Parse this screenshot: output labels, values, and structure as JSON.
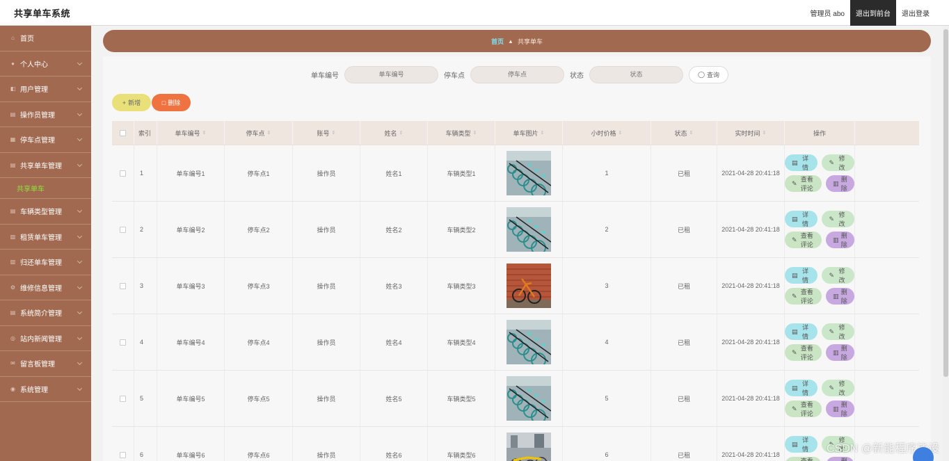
{
  "header": {
    "title": "共享单车系统",
    "user": "管理员 abo",
    "front_label": "退出到前台",
    "logout_label": "退出登录"
  },
  "sidebar": {
    "items": [
      {
        "label": "首页",
        "icon": "home-icon"
      },
      {
        "label": "个人中心",
        "icon": "user-icon"
      },
      {
        "label": "用户管理",
        "icon": "users-icon"
      },
      {
        "label": "操作员管理",
        "icon": "list-icon"
      },
      {
        "label": "停车点管理",
        "icon": "grid-icon"
      },
      {
        "label": "共享单车管理",
        "icon": "list-icon"
      },
      {
        "label": "车辆类型管理",
        "icon": "list-icon"
      },
      {
        "label": "租赁单车管理",
        "icon": "chart-icon"
      },
      {
        "label": "归还单车管理",
        "icon": "chart-icon"
      },
      {
        "label": "维修信息管理",
        "icon": "settings-icon"
      },
      {
        "label": "系统简介管理",
        "icon": "list-icon"
      },
      {
        "label": "站内新闻管理",
        "icon": "globe-icon"
      },
      {
        "label": "留言板管理",
        "icon": "message-icon"
      },
      {
        "label": "系统管理",
        "icon": "database-icon"
      }
    ],
    "active_sub": "共享单车"
  },
  "breadcrumb": {
    "home": "首页",
    "current": "共享单车"
  },
  "search": {
    "fields": [
      {
        "label": "单车编号",
        "placeholder": "单车编号"
      },
      {
        "label": "停车点",
        "placeholder": "停车点"
      },
      {
        "label": "状态",
        "placeholder": "状态"
      }
    ],
    "button": "查询"
  },
  "actions": {
    "add": "新增",
    "delete": "删除"
  },
  "table": {
    "columns": [
      "索引",
      "单车编号",
      "停车点",
      "账号",
      "姓名",
      "车辆类型",
      "单车图片",
      "小时价格",
      "状态",
      "实时时间",
      "操作"
    ],
    "rows": [
      {
        "index": "1",
        "bike_no": "单车编号1",
        "stop": "停车点1",
        "account": "操作员",
        "name": "姓名1",
        "type": "车辆类型1",
        "price": "1",
        "status": "已租",
        "time": "2021-04-28 20:41:18",
        "img": "rack"
      },
      {
        "index": "2",
        "bike_no": "单车编号2",
        "stop": "停车点2",
        "account": "操作员",
        "name": "姓名2",
        "type": "车辆类型2",
        "price": "2",
        "status": "已租",
        "time": "2021-04-28 20:41:18",
        "img": "rack"
      },
      {
        "index": "3",
        "bike_no": "单车编号3",
        "stop": "停车点3",
        "account": "操作员",
        "name": "姓名3",
        "type": "车辆类型3",
        "price": "3",
        "status": "已租",
        "time": "2021-04-28 20:41:18",
        "img": "wall"
      },
      {
        "index": "4",
        "bike_no": "单车编号4",
        "stop": "停车点4",
        "account": "操作员",
        "name": "姓名4",
        "type": "车辆类型4",
        "price": "4",
        "status": "已租",
        "time": "2021-04-28 20:41:18",
        "img": "rack"
      },
      {
        "index": "5",
        "bike_no": "单车编号5",
        "stop": "停车点5",
        "account": "操作员",
        "name": "姓名5",
        "type": "车辆类型5",
        "price": "5",
        "status": "已租",
        "time": "2021-04-28 20:41:18",
        "img": "rack"
      },
      {
        "index": "6",
        "bike_no": "单车编号6",
        "stop": "停车点6",
        "account": "操作员",
        "name": "姓名6",
        "type": "车辆类型6",
        "price": "6",
        "status": "已租",
        "time": "2021-04-28 20:41:18",
        "img": "street"
      }
    ],
    "ops": {
      "detail": "详情",
      "edit": "修改",
      "comment": "查看评论",
      "remove": "删除"
    }
  },
  "watermark": "CSDN @新能程序毕设",
  "colors": {
    "sidebar": "#a16a50",
    "accent_green": "#8fe03c",
    "add": "#e9e07a",
    "delete": "#ef7341"
  }
}
